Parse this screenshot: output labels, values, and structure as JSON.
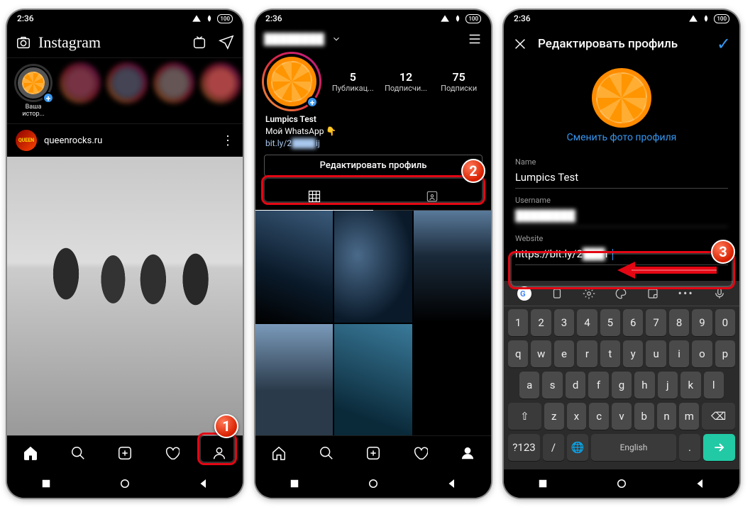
{
  "status": {
    "time": "2:36",
    "battery": "100"
  },
  "screen1": {
    "brand": "Instagram",
    "your_story": "Ваша истор...",
    "post_user": "queenrocks.ru",
    "post_avatar_text": "QUEEN"
  },
  "screen2": {
    "stats": {
      "posts": {
        "num": "5",
        "label": "Публикац..."
      },
      "followers": {
        "num": "12",
        "label": "Подписчи..."
      },
      "following": {
        "num": "75",
        "label": "Подписки"
      }
    },
    "bio": {
      "name": "Lumpics Test",
      "line": "Мой WhatsApp 👇",
      "link_prefix": "bit.ly/2",
      "link_suffix": "ij"
    },
    "edit_button": "Редактировать профиль"
  },
  "screen3": {
    "title": "Редактировать профиль",
    "change_photo": "Сменить фото профиля",
    "fields": {
      "name_label": "Name",
      "name_value": "Lumpics Test",
      "username_label": "Username",
      "website_label": "Website",
      "website_value": "https://bit.ly/2"
    },
    "keyboard": {
      "row_num": [
        "1",
        "2",
        "3",
        "4",
        "5",
        "6",
        "7",
        "8",
        "9",
        "0"
      ],
      "row1": [
        "q",
        "w",
        "e",
        "r",
        "t",
        "y",
        "u",
        "i",
        "o",
        "p"
      ],
      "row2": [
        "a",
        "s",
        "d",
        "f",
        "g",
        "h",
        "j",
        "k",
        "l"
      ],
      "row3": [
        "z",
        "x",
        "c",
        "v",
        "b",
        "n",
        "m"
      ],
      "sym": "?123",
      "slash": "/",
      "space": "English",
      "dot": "."
    }
  },
  "badges": {
    "b1": "1",
    "b2": "2",
    "b3": "3"
  }
}
